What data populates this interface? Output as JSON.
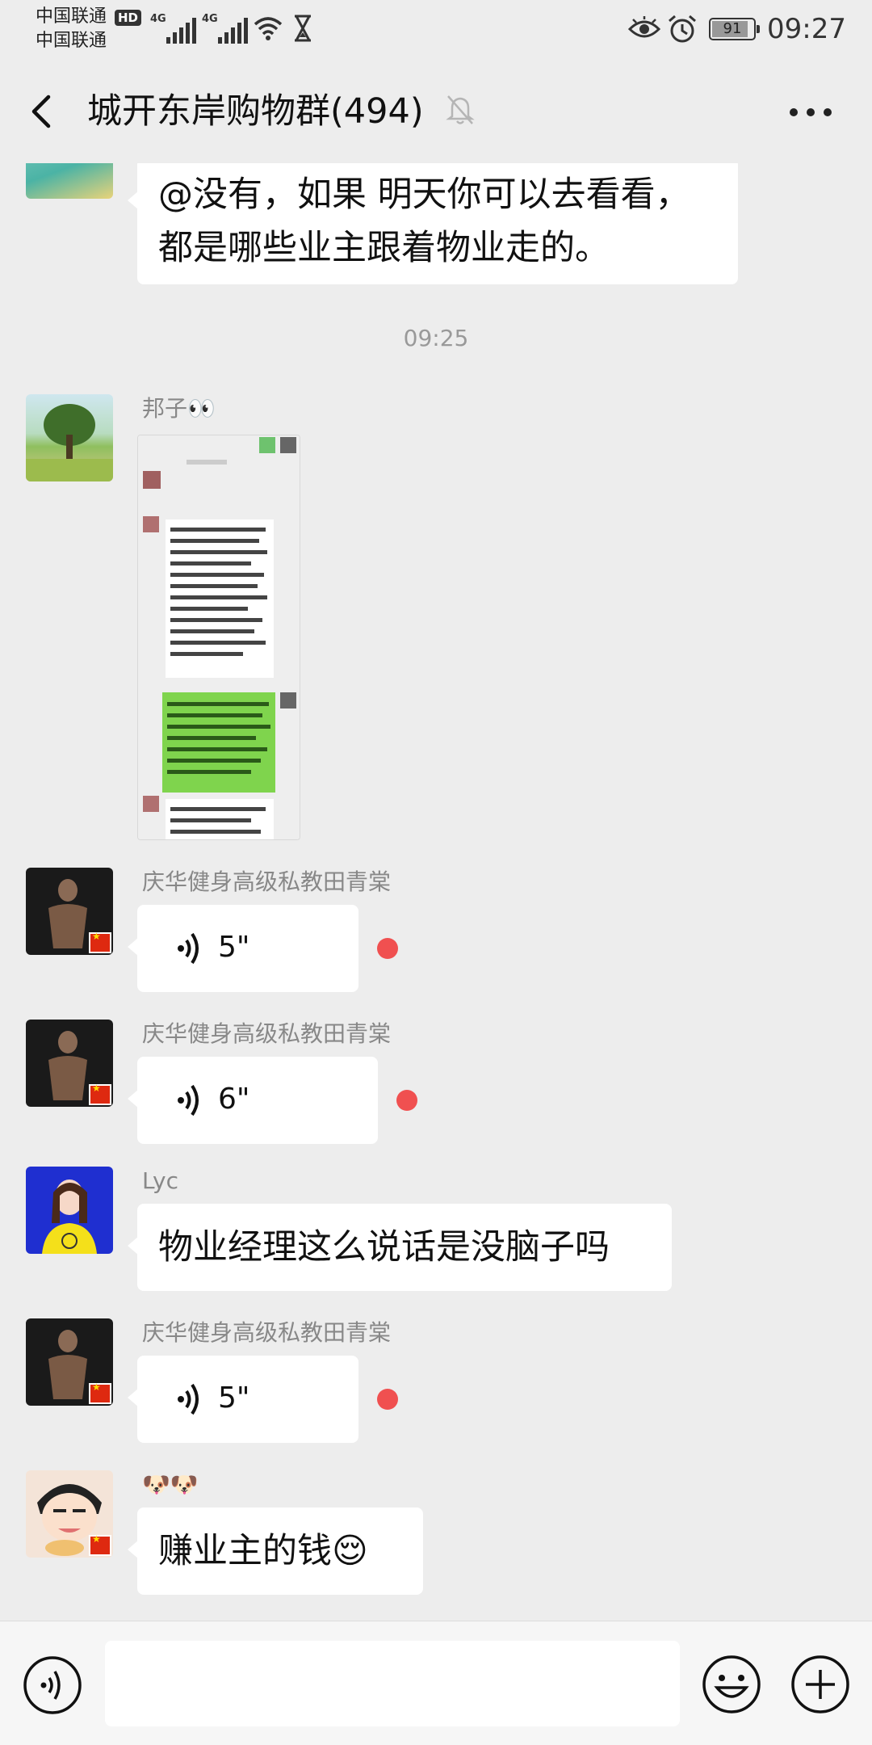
{
  "status_bar": {
    "carrier1": "中国联通",
    "carrier2": "中国联通",
    "hd": "HD",
    "network1": "4G",
    "network2": "4G",
    "battery": "91",
    "time": "09:27"
  },
  "nav": {
    "title": "城开东岸购物群(494)"
  },
  "messages": {
    "m0_text_line1": "@没有，如果  明天你可以去看看，",
    "m0_text_line2": "都是哪些业主跟着物业走的。",
    "time_divider": "09:25",
    "m1_sender": "邦子👀",
    "m2_sender": "庆华健身高级私教田青棠",
    "m2_duration": "5\"",
    "m3_sender": "庆华健身高级私教田青棠",
    "m3_duration": "6\"",
    "m4_sender": "Lyc",
    "m4_text": "物业经理这么说话是没脑子吗",
    "m5_sender": "庆华健身高级私教田青棠",
    "m5_duration": "5\"",
    "m6_sender": "🐶🐶",
    "m6_text": "赚业主的钱😌"
  },
  "input_bar": {
    "placeholder": ""
  },
  "colors": {
    "background": "#ededed",
    "bubble": "#ffffff",
    "unread_dot": "#f05050",
    "flag_red": "#de2910",
    "image_green": "#7fd44d"
  },
  "icons": [
    "back-arrow-icon",
    "mute-bell-icon",
    "more-icon",
    "voice-wave-icon",
    "voice-toggle-icon",
    "emoji-icon",
    "plus-icon",
    "wifi-icon",
    "hourglass-icon",
    "eye-icon",
    "alarm-icon"
  ]
}
